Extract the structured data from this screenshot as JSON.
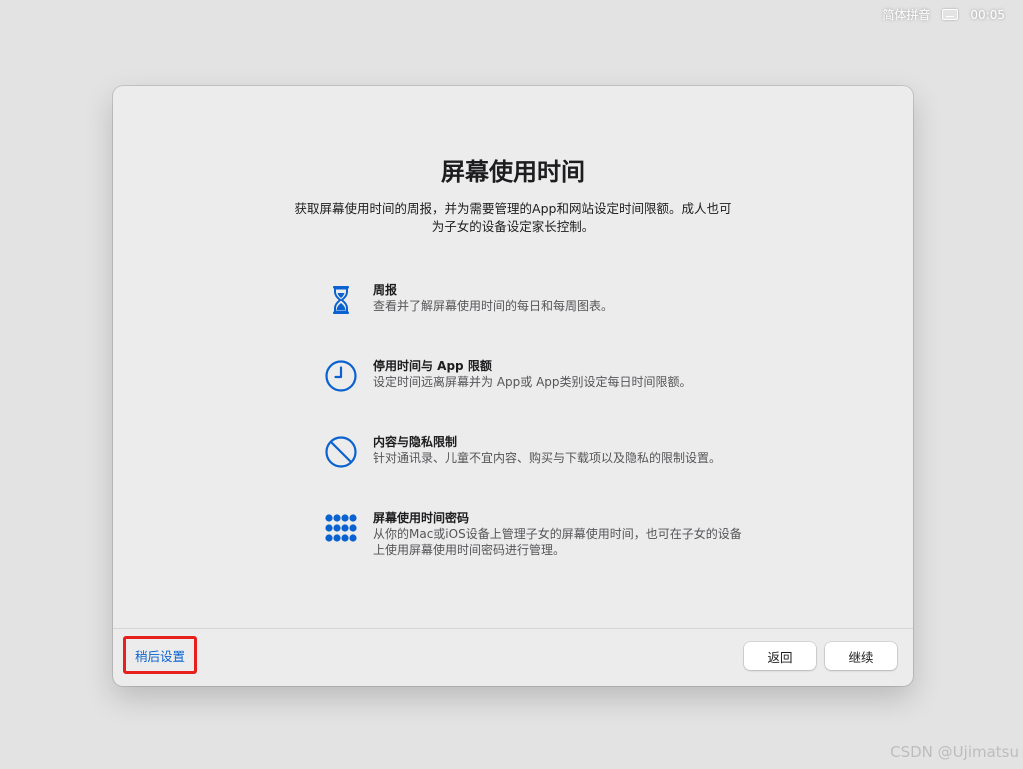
{
  "menubar": {
    "input_method": "简体拼音",
    "keyboard_icon": "keyboard-icon",
    "time": "00:05"
  },
  "dialog": {
    "title": "屏幕使用时间",
    "subtitle": "获取屏幕使用时间的周报，并为需要管理的App和网站设定时间限额。成人也可为子女的设备设定家长控制。",
    "features": [
      {
        "icon": "hourglass-icon",
        "title": "周报",
        "description": "查看并了解屏幕使用时间的每日和每周图表。"
      },
      {
        "icon": "clock-icon",
        "title": "停用时间与 App 限额",
        "description": "设定时间远离屏幕并为 App或 App类别设定每日时间限额。"
      },
      {
        "icon": "prohibited-icon",
        "title": "内容与隐私限制",
        "description": "针对通讯录、儿童不宜内容、购买与下载项以及隐私的限制设置。"
      },
      {
        "icon": "passcode-keypad-icon",
        "title": "屏幕使用时间密码",
        "description": "从你的Mac或iOS设备上管理子女的屏幕使用时间，也可在子女的设备上使用屏幕使用时间密码进行管理。"
      }
    ],
    "later_label": "稍后设置",
    "back_label": "返回",
    "continue_label": "继续"
  },
  "watermark": "CSDN @Ujimatsu",
  "colors": {
    "accent": "#0a62d0",
    "highlight_border": "#e8201c",
    "window_bg": "#ececec",
    "desktop_bg": "#e3e3e3"
  }
}
